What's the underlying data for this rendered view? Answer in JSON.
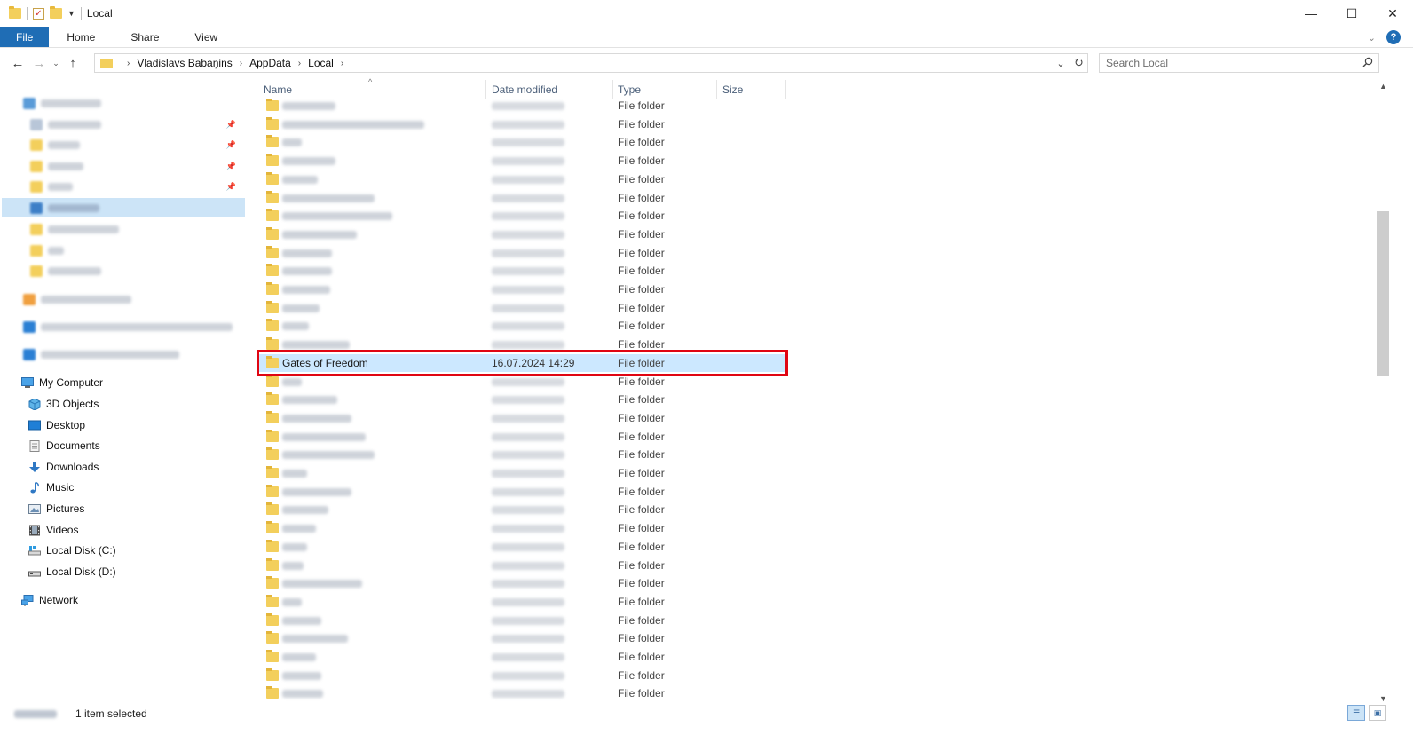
{
  "window": {
    "title": "Local"
  },
  "window_controls": {
    "minimize": "—",
    "maximize": "☐",
    "close": "✕"
  },
  "ribbon": {
    "tabs": [
      "File",
      "Home",
      "Share",
      "View"
    ]
  },
  "address": {
    "crumbs": [
      "Vladislavs Babaņins",
      "AppData",
      "Local"
    ]
  },
  "search": {
    "placeholder": "Search Local"
  },
  "columns": {
    "name": "Name",
    "date": "Date modified",
    "type": "Type",
    "size": "Size"
  },
  "nav": {
    "this_pc": [
      {
        "label": "My Computer",
        "icon": "computer-icon"
      },
      {
        "label": "3D Objects",
        "icon": "cube-icon"
      },
      {
        "label": "Desktop",
        "icon": "desktop-icon"
      },
      {
        "label": "Documents",
        "icon": "document-icon"
      },
      {
        "label": "Downloads",
        "icon": "download-arrow-icon"
      },
      {
        "label": "Music",
        "icon": "music-note-icon"
      },
      {
        "label": "Pictures",
        "icon": "picture-icon"
      },
      {
        "label": "Videos",
        "icon": "film-icon"
      },
      {
        "label": "Local Disk (C:)",
        "icon": "drive-icon"
      },
      {
        "label": "Local Disk (D:)",
        "icon": "drive-icon"
      }
    ],
    "network": {
      "label": "Network",
      "icon": "network-icon"
    }
  },
  "files": {
    "type_label": "File folder",
    "selected": {
      "name": "Gates of Freedom",
      "date": "16.07.2024 14:29",
      "type": "File folder"
    }
  },
  "status": {
    "selected_text": "1 item selected"
  },
  "colors": {
    "accent": "#1f6db5",
    "selection": "#cce8ff",
    "highlight_box": "#e00613",
    "folder": "#f3cf5c"
  }
}
